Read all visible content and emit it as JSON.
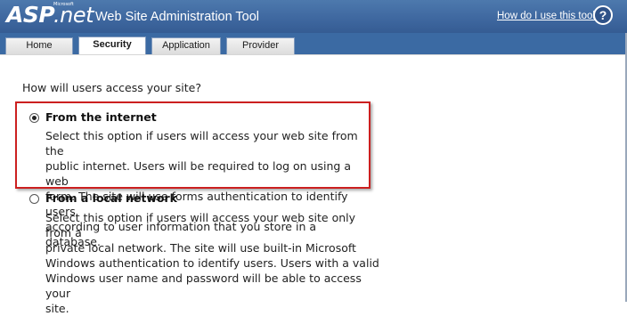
{
  "header": {
    "logo": {
      "asp": "ASP",
      "net": ".net",
      "microsoft": "Microsoft"
    },
    "title": "Web Site Administration Tool",
    "help_link": "How do I use this tool?",
    "help_icon": "?"
  },
  "tabs": [
    {
      "label": "Home"
    },
    {
      "label": "Security"
    },
    {
      "label": "Application"
    },
    {
      "label": "Provider"
    }
  ],
  "active_tab": "Security",
  "main": {
    "question": "How will users access your site?",
    "options": [
      {
        "label": "From the internet",
        "selected": true,
        "description": "Select this option if users will access your web site from the\npublic internet. Users will be required to log on using a web\nform. The site will use forms authentication to identify users\naccording to user information that you store in a database."
      },
      {
        "label": "From a local network",
        "selected": false,
        "description": "Select this option if users will access your web site only from a\nprivate local network. The site will use built-in Microsoft\nWindows authentication to identify users. Users with a valid\nWindows user name and password will be able to access your\nsite."
      }
    ]
  },
  "colors": {
    "header_blue": "#3f68a0",
    "highlight_red": "#cc2020"
  }
}
